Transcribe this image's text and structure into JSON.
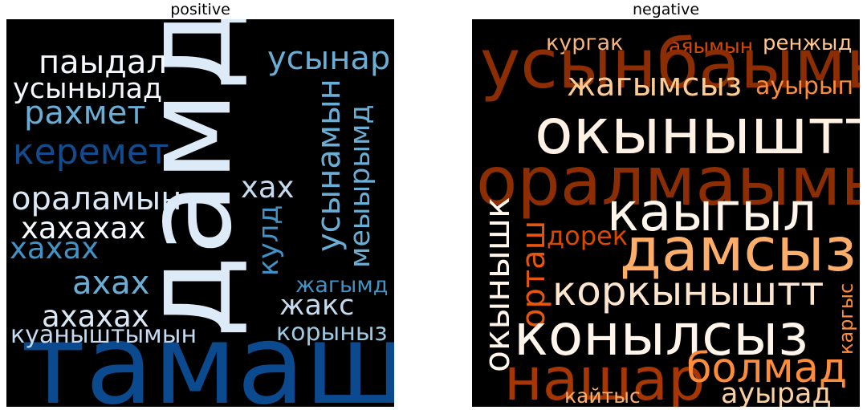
{
  "chart_data": [
    {
      "type": "wordcloud",
      "title": "positive",
      "background": "#000000",
      "colormap": "Blues",
      "words": [
        {
          "text": "тамаш",
          "weight": 1.0,
          "color": "#0b4a8f",
          "rotate": 0
        },
        {
          "text": "дамд",
          "weight": 0.93,
          "color": "#ddeaf7",
          "rotate": -90
        },
        {
          "text": "керемет",
          "weight": 0.45,
          "color": "#124c8e",
          "rotate": 0
        },
        {
          "text": "паыдал",
          "weight": 0.4,
          "color": "#f4f8fd",
          "rotate": 0
        },
        {
          "text": "рахмет",
          "weight": 0.4,
          "color": "#6aaed6",
          "rotate": 0
        },
        {
          "text": "усынар",
          "weight": 0.4,
          "color": "#6aaed6",
          "rotate": 0
        },
        {
          "text": "усынылад",
          "weight": 0.36,
          "color": "#f4f8fd",
          "rotate": 0
        },
        {
          "text": "ораламын",
          "weight": 0.4,
          "color": "#dbe9f6",
          "rotate": 0
        },
        {
          "text": "хахахах",
          "weight": 0.38,
          "color": "#f7fbff",
          "rotate": 0
        },
        {
          "text": "ахах",
          "weight": 0.4,
          "color": "#6aaed6",
          "rotate": 0
        },
        {
          "text": "хахах",
          "weight": 0.38,
          "color": "#4292c6",
          "rotate": 0
        },
        {
          "text": "ахахах",
          "weight": 0.38,
          "color": "#dbe9f6",
          "rotate": 0
        },
        {
          "text": "куаныштымын",
          "weight": 0.31,
          "color": "#c6dbef",
          "rotate": 0
        },
        {
          "text": "хах",
          "weight": 0.38,
          "color": "#c6dbef",
          "rotate": 0
        },
        {
          "text": "кулд",
          "weight": 0.36,
          "color": "#4292c6",
          "rotate": -90
        },
        {
          "text": "усынамын",
          "weight": 0.4,
          "color": "#6aaed6",
          "rotate": -90
        },
        {
          "text": "меыырымд",
          "weight": 0.36,
          "color": "#6aaed6",
          "rotate": -90
        },
        {
          "text": "жагымд",
          "weight": 0.28,
          "color": "#4292c6",
          "rotate": 0
        },
        {
          "text": "жакс",
          "weight": 0.36,
          "color": "#c6dbef",
          "rotate": 0
        },
        {
          "text": "корыныз",
          "weight": 0.31,
          "color": "#9ecae1",
          "rotate": 0
        }
      ]
    },
    {
      "type": "wordcloud",
      "title": "negative",
      "background": "#000000",
      "colormap": "Oranges",
      "words": [
        {
          "text": "кургак",
          "weight": 0.28,
          "color": "#f7b47e",
          "rotate": 0
        },
        {
          "text": "аяымын",
          "weight": 0.26,
          "color": "#d94801",
          "rotate": 0
        },
        {
          "text": "ренжыд",
          "weight": 0.27,
          "color": "#fdc591",
          "rotate": 0
        },
        {
          "text": "усынбаымын",
          "weight": 0.88,
          "color": "#8c2d04",
          "rotate": 0
        },
        {
          "text": "жагымсыз",
          "weight": 0.42,
          "color": "#fdcc95",
          "rotate": 0
        },
        {
          "text": "ауырып",
          "weight": 0.3,
          "color": "#fd8d3c",
          "rotate": 0
        },
        {
          "text": "окыныштт",
          "weight": 0.8,
          "color": "#fff1e3",
          "rotate": 0
        },
        {
          "text": "оралмаымын",
          "weight": 0.87,
          "color": "#8c2d04",
          "rotate": 0
        },
        {
          "text": "каыгыл",
          "weight": 0.68,
          "color": "#fff5eb",
          "rotate": 0
        },
        {
          "text": "окынышк",
          "weight": 0.44,
          "color": "#fff5eb",
          "rotate": -90
        },
        {
          "text": "орташ",
          "weight": 0.42,
          "color": "#e6550d",
          "rotate": -90
        },
        {
          "text": "дорек",
          "weight": 0.32,
          "color": "#d94801",
          "rotate": 0
        },
        {
          "text": "дамсыз",
          "weight": 0.78,
          "color": "#fdae6b",
          "rotate": 0
        },
        {
          "text": "коркыныштт",
          "weight": 0.52,
          "color": "#fee6ce",
          "rotate": 0
        },
        {
          "text": "каргыс",
          "weight": 0.25,
          "color": "#fd8d3c",
          "rotate": -90
        },
        {
          "text": "конылсыз",
          "weight": 0.73,
          "color": "#fff5eb",
          "rotate": 0
        },
        {
          "text": "нашар",
          "weight": 0.76,
          "color": "#a63603",
          "rotate": 0
        },
        {
          "text": "болмад",
          "weight": 0.53,
          "color": "#fd8d3c",
          "rotate": 0
        },
        {
          "text": "кайтыс",
          "weight": 0.26,
          "color": "#fdae6b",
          "rotate": 0
        },
        {
          "text": "ауырад",
          "weight": 0.36,
          "color": "#fdd0a2",
          "rotate": 0
        }
      ]
    }
  ]
}
